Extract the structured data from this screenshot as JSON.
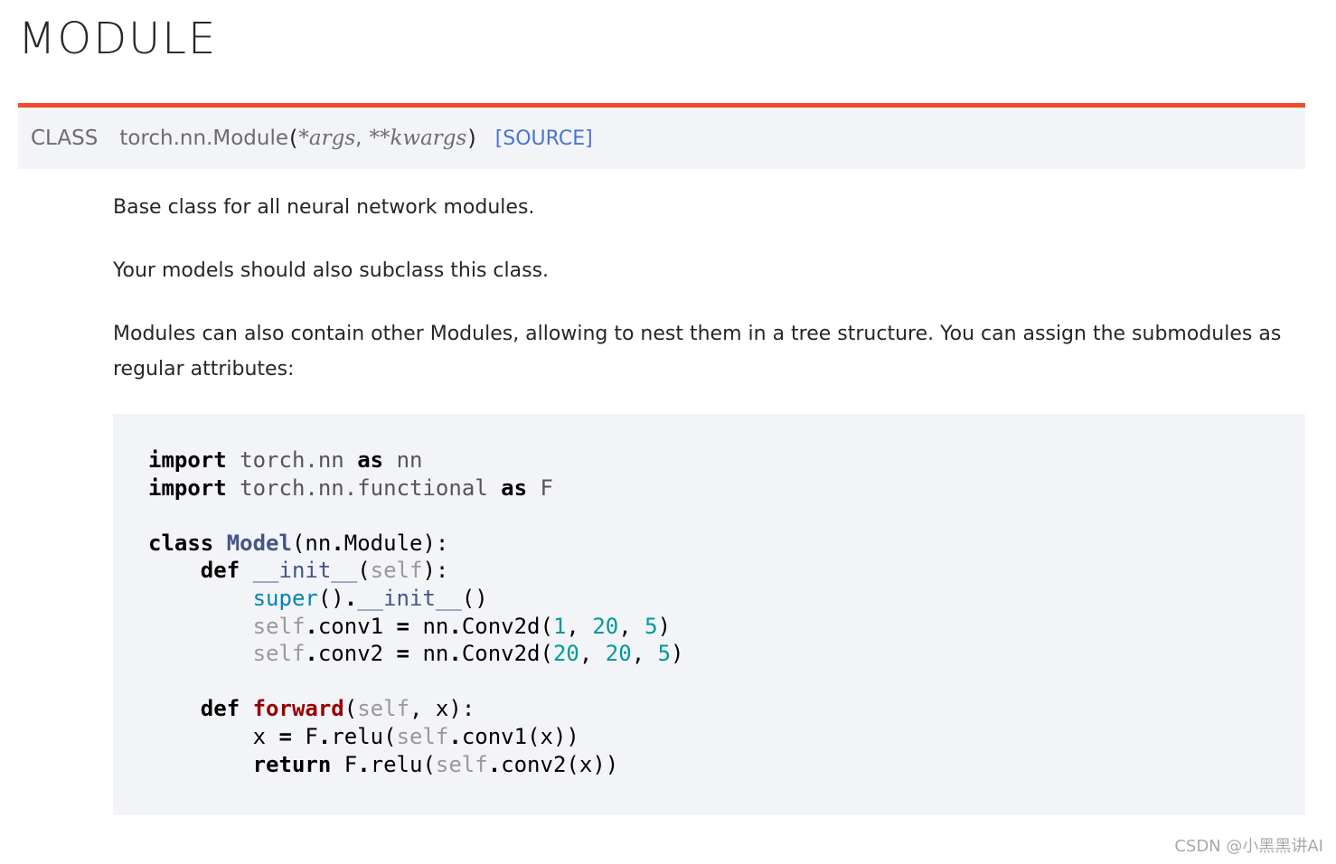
{
  "page": {
    "title": "MODULE"
  },
  "signature": {
    "prefix": "CLASS",
    "name": "torch.nn.Module",
    "open_paren": "(",
    "params": [
      "*args",
      "**kwargs"
    ],
    "separator": ",",
    "close_paren": ")",
    "source_label": "[SOURCE]"
  },
  "description": [
    "Base class for all neural network modules.",
    "Your models should also subclass this class.",
    "Modules can also contain other Modules, allowing to nest them in a tree structure. You can assign the submodules as regular attributes:"
  ],
  "code": {
    "lines": [
      "import torch.nn as nn",
      "import torch.nn.functional as F",
      "",
      "class Model(nn.Module):",
      "    def __init__(self):",
      "        super().__init__()",
      "        self.conv1 = nn.Conv2d(1, 20, 5)",
      "        self.conv2 = nn.Conv2d(20, 20, 5)",
      "",
      "    def forward(self, x):",
      "        x = F.relu(self.conv1(x))",
      "        return F.relu(self.conv2(x))"
    ]
  },
  "watermark": "CSDN @小黑黑讲AI",
  "colors": {
    "accent": "#ee4c2c",
    "link": "#4974d1",
    "signature_bg": "#f3f4f7",
    "code_bg": "#f3f4f7",
    "keyword": "#000000",
    "class_name": "#445588",
    "function_name": "#990000",
    "builtin": "#0086b3",
    "number": "#009999",
    "self": "#999999"
  }
}
